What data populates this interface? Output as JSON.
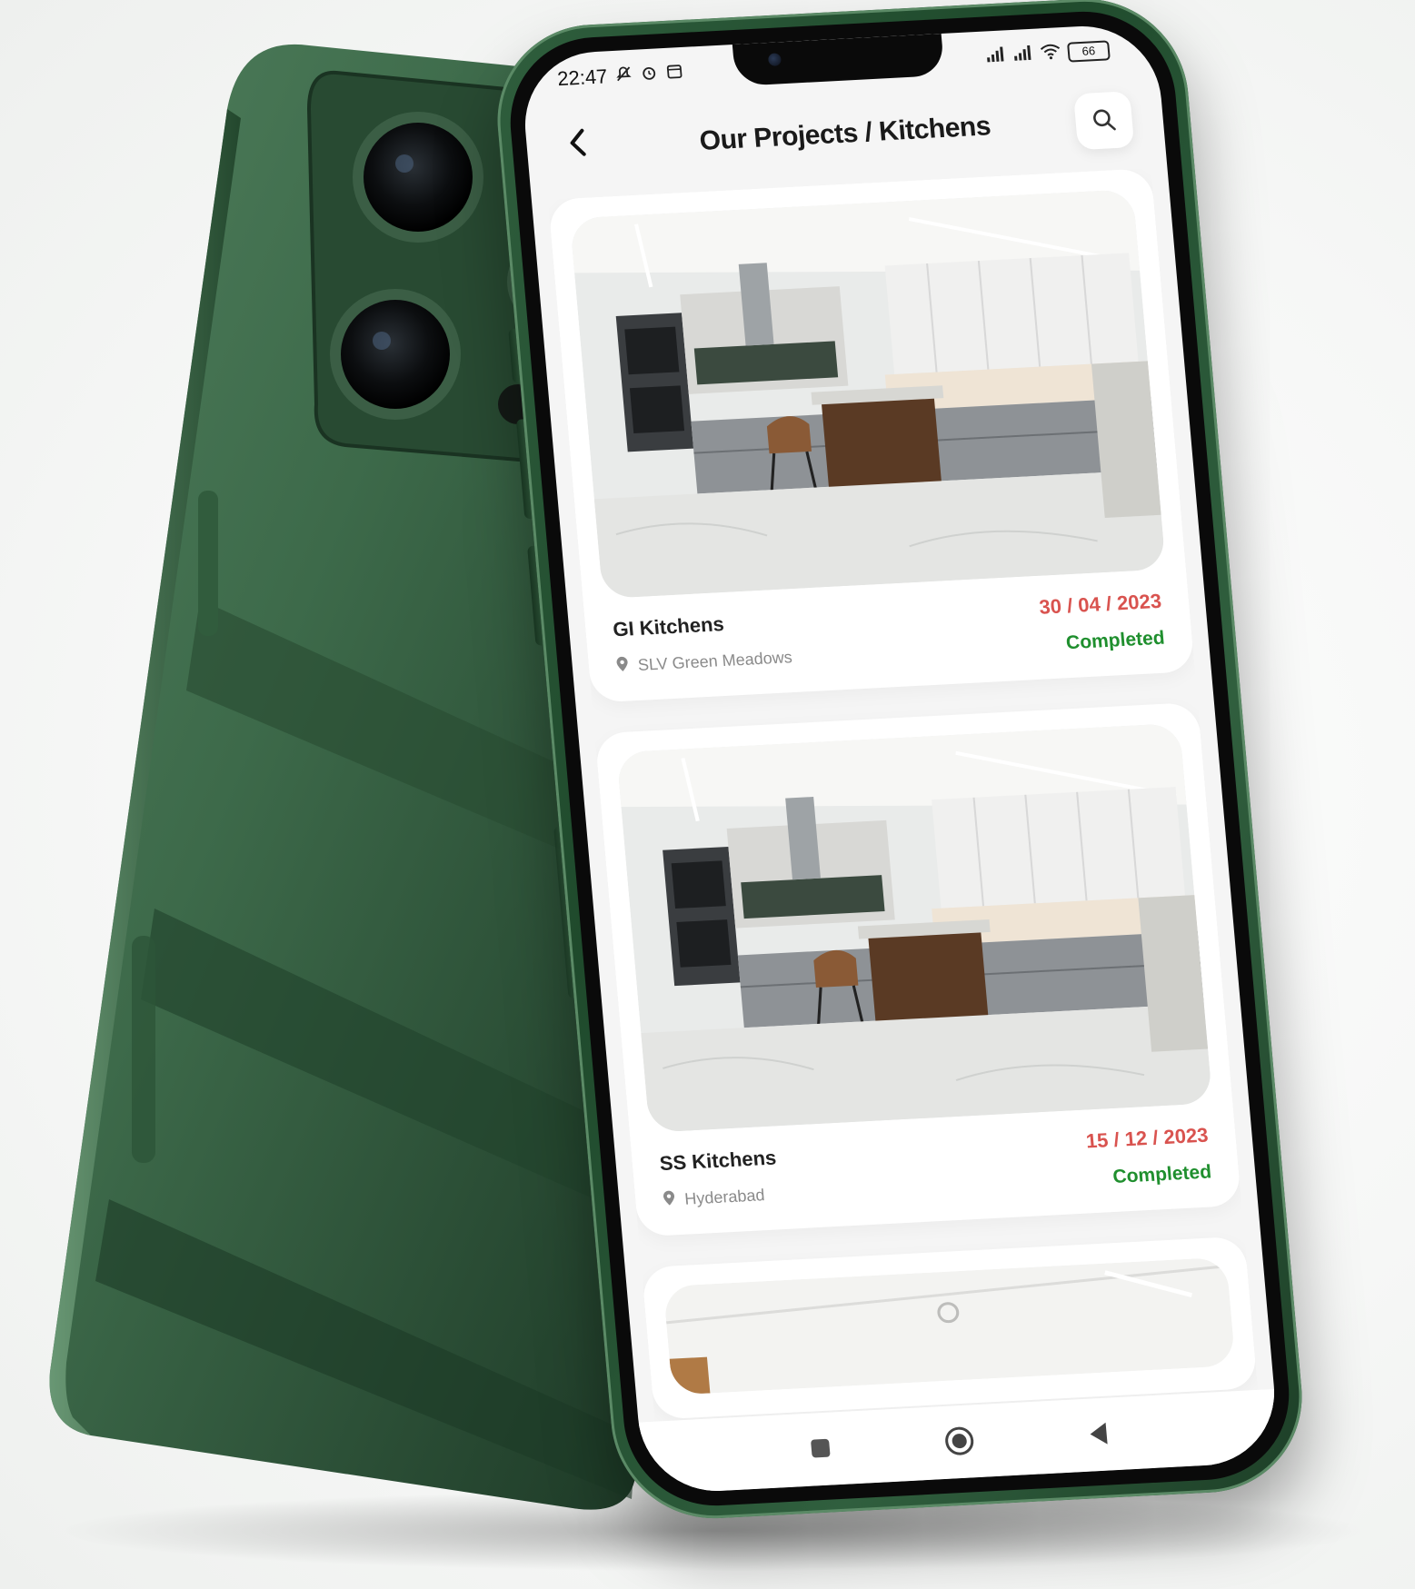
{
  "status_bar": {
    "time": "22:47",
    "battery": "66",
    "left_icons": [
      "mute-icon",
      "alarm-icon",
      "calendar-icon"
    ],
    "right_icons": [
      "signal-icon",
      "signal-icon",
      "wifi-icon",
      "battery-icon"
    ]
  },
  "header": {
    "title": "Our Projects / Kitchens",
    "back_icon": "chevron-left-icon",
    "search_icon": "search-icon"
  },
  "projects": [
    {
      "name": "GI Kitchens",
      "location": "SLV Green Meadows",
      "date": "30 / 04 / 2023",
      "status": "Completed"
    },
    {
      "name": "SS Kitchens",
      "location": "Hyderabad",
      "date": "15 / 12 / 2023",
      "status": "Completed"
    }
  ],
  "nav": {
    "items": [
      "recent-apps-icon",
      "home-icon",
      "back-triangle-icon"
    ]
  },
  "colors": {
    "date": "#d9534f",
    "status": "#1f8f2e",
    "phone_body": "#2f5e3d",
    "screen_bg": "#f5f5f5"
  }
}
